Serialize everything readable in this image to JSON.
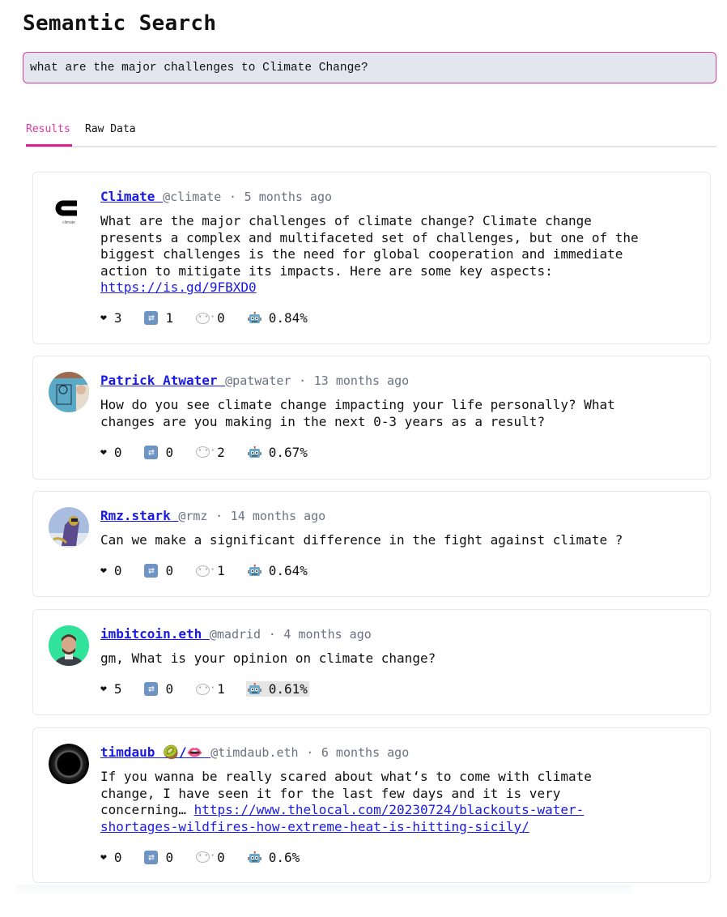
{
  "page": {
    "title": "Semantic Search"
  },
  "search": {
    "value": "what are the major challenges to Climate Change?",
    "accent_color": "#d63c9a"
  },
  "tabs": [
    {
      "label": "Results",
      "active": true
    },
    {
      "label": "Raw Data",
      "active": false
    }
  ],
  "results": [
    {
      "display_name": "Climate",
      "handle": "@climate",
      "time": "5 months ago",
      "avatar": "climate-logo",
      "avatar_caption": "climate",
      "text": "What are the major challenges of climate change? Climate change\npresents a complex and multifaceted set of challenges, but one of the\nbiggest challenges is the need for global cooperation and immediate\naction to mitigate its impacts. Here are some key aspects:",
      "link": "https://is.gd/9FBXD0",
      "likes": "3",
      "recasts": "1",
      "replies": "0",
      "score": "0.84%"
    },
    {
      "display_name": "Patrick Atwater",
      "handle": "@patwater",
      "time": "13 months ago",
      "avatar": "photo-person-blue-shirt",
      "text": "How do you see climate change impacting your life personally? What\nchanges are you making in the next 0-3 years as a result?",
      "likes": "0",
      "recasts": "0",
      "replies": "2",
      "score": "0.67%"
    },
    {
      "display_name": "Rmz.stark",
      "handle": "@rmz",
      "time": "14 months ago",
      "avatar": "illustration-astronaut",
      "text": "Can we make a significant difference in the fight against climate ?",
      "likes": "0",
      "recasts": "0",
      "replies": "1",
      "score": "0.64%"
    },
    {
      "display_name": "imbitcoin.eth",
      "handle": "@madrid",
      "time": "4 months ago",
      "avatar": "photo-person-green-bg",
      "text": "gm, What is your opinion on climate change?",
      "likes": "5",
      "recasts": "0",
      "replies": "1",
      "score": "0.61%"
    },
    {
      "display_name": "timdaub 🥝/👄",
      "handle": "@timdaub.eth",
      "time": "6 months ago",
      "avatar": "black-circle-ring",
      "text": "If you wanna be really scared about what‘s to come with climate\nchange, I have seen it for the last few days and it is very\nconcerning… ",
      "link": "https://www.thelocal.com/20230724/blackouts-water-shortages-wildfires-how-extreme-heat-is-hitting-sicily/",
      "link_display": "https://www.thelocal.com/20230724/blackouts-water-\nshortages-wildfires-how-extreme-heat-is-hitting-sicily/",
      "likes": "0",
      "recasts": "0",
      "replies": "0",
      "score": "0.6%"
    }
  ],
  "icons": {
    "like": "heart-icon",
    "recast": "recast-icon",
    "reply": "speech-bubble-icon",
    "score": "robot-icon"
  },
  "separator": "·"
}
